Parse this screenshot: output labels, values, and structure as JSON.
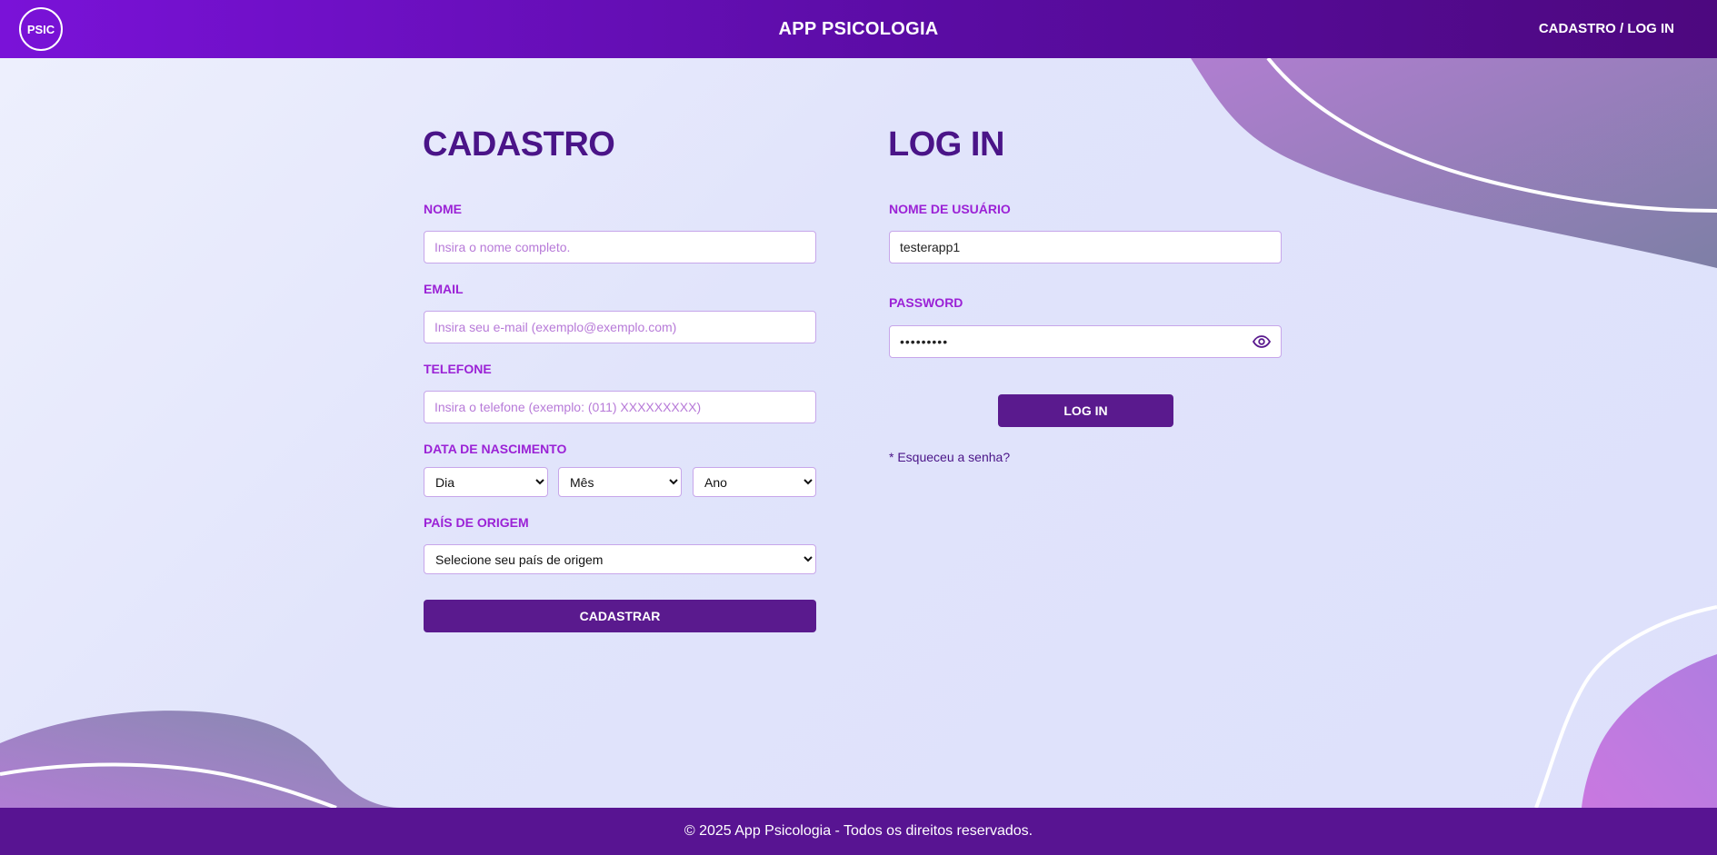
{
  "header": {
    "logo_text": "PSIC",
    "app_title": "APP PSICOLOGIA",
    "nav_link": "CADASTRO / LOG IN"
  },
  "signup": {
    "title": "CADASTRO",
    "name_label": "NOME",
    "name_placeholder": "Insira o nome completo.",
    "name_value": "",
    "email_label": "EMAIL",
    "email_placeholder": "Insira seu e-mail (exemplo@exemplo.com)",
    "email_value": "",
    "phone_label": "TELEFONE",
    "phone_placeholder": "Insira o telefone (exemplo: (011) XXXXXXXXX)",
    "phone_value": "",
    "birth_label": "DATA DE NASCIMENTO",
    "day_selected": "Dia",
    "month_selected": "Mês",
    "year_selected": "Ano",
    "country_label": "PAÍS DE ORIGEM",
    "country_selected": "Selecione seu país de origem",
    "submit_label": "CADASTRAR"
  },
  "login": {
    "title": "LOG IN",
    "username_label": "NOME DE USUÁRIO",
    "username_value": "testerapp1",
    "password_label": "PASSWORD",
    "password_value": "•••••••••",
    "submit_label": "LOG IN",
    "forgot_label": "* Esqueceu a senha?"
  },
  "footer": {
    "text": "© 2025 App Psicologia - Todos os direitos reservados."
  },
  "colors": {
    "header_start": "#7a12d8",
    "header_end": "#4d087f",
    "title": "#4a1488",
    "label": "#9b22d6",
    "button": "#5a1a8e",
    "footer": "#581492",
    "page_background": "#dde0fb"
  },
  "icons": {
    "password_toggle": "eye-icon",
    "select_arrow": "chevron-down-icon"
  }
}
